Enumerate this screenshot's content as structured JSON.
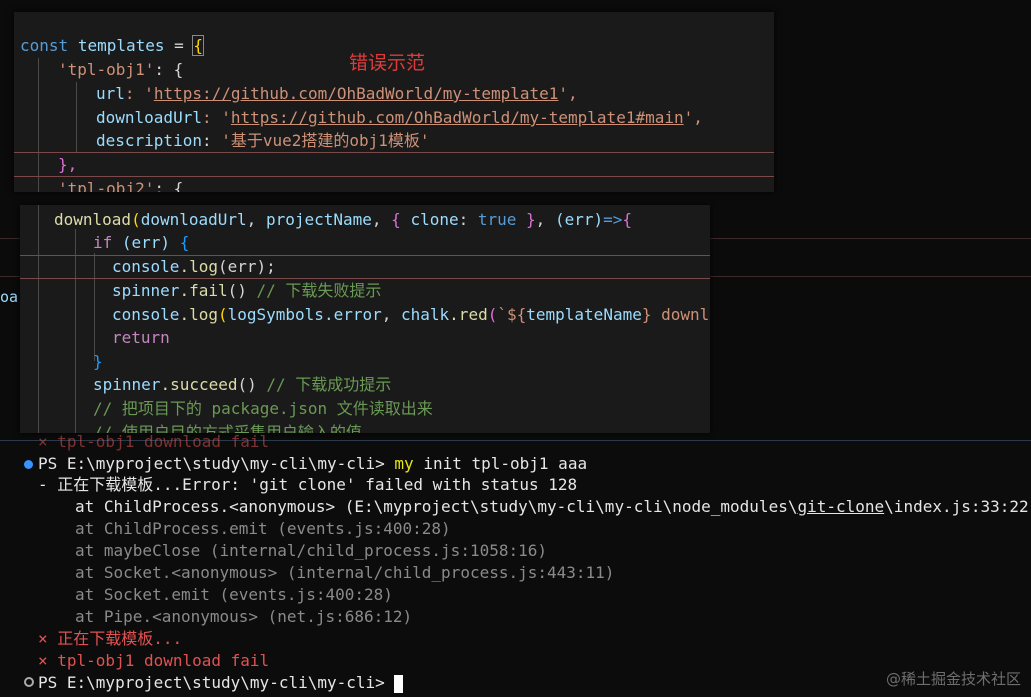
{
  "snippet1": {
    "label": "错误示范",
    "lines": {
      "l1": {
        "kw": "const",
        "name": "templates",
        "eq": " = ",
        "brace": "{"
      },
      "l2": {
        "key": "'tpl-obj1'",
        "rest": ": {"
      },
      "l3": {
        "key": "url",
        "sep": ": '",
        "url": "https://github.com/OhBadWorld/my-template1",
        "end": "',"
      },
      "l4": {
        "key": "downloadUrl",
        "sep": ": '",
        "url": "https://github.com/OhBadWorld/my-template1#main",
        "end": "',"
      },
      "l5": {
        "key": "description",
        "sep": ": ",
        "str": "'基于vue2搭建的obj1模板'"
      },
      "l6": {
        "text": "},"
      },
      "l7": {
        "key": "'tpl-obj2'",
        "rest": ": {"
      }
    }
  },
  "snippet2": {
    "l1": {
      "fn": "download",
      "args1": "(",
      "v1": "downloadUrl",
      "c1": ", ",
      "v2": "projectName",
      "c2": ", ",
      "ob": "{",
      "k": " clone",
      "colon": ": ",
      "t": "true",
      "cb": " }",
      "c3": ", ",
      "p": "(err)",
      "arrow": "=>",
      "ob2": "{"
    },
    "l2": {
      "kw": "if",
      "cond": " (err) ",
      "ob": "{"
    },
    "l3": {
      "obj": "console",
      "fn": ".log",
      "args": "(err);"
    },
    "l4": {
      "obj": "spinner",
      "fn": ".fail",
      "args": "() ",
      "cm": "// 下载失败提示"
    },
    "l5": {
      "obj": "console",
      "fn": ".log",
      "a1": "(",
      "v1": "logSymbols",
      "v2": ".error",
      "c": ", ",
      "v3": "chalk",
      "f2": ".red",
      "a2": "(",
      "s": "`${",
      "tn": "templateName",
      "s2": "} downl"
    },
    "l6": {
      "kw": "return"
    },
    "l7": {
      "text": "}"
    },
    "l8": {
      "obj": "spinner",
      "fn": ".succeed",
      "args": "() ",
      "cm": "// 下载成功提示"
    },
    "l9": {
      "cm": "// 把项目下的 package.json 文件读取出来"
    },
    "l10": {
      "cm": "// 使用户目的方式采集用户输入的值"
    }
  },
  "background": {
    "edge_text": "oa"
  },
  "terminal": {
    "prompt1": "PS E:\\myproject\\study\\my-cli\\my-cli> ",
    "cmd": "my",
    "cmd_args": " init tpl-obj1 aaa",
    "err_line": "- 正在下载模板...Error: 'git clone' failed with status 128",
    "stack1_pre": "at ChildProcess.<anonymous> (E:\\myproject\\study\\my-cli\\my-cli\\node_modules\\",
    "stack1_link": "git-clone",
    "stack1_post": "\\index.js:33:22)",
    "stack2": "at ChildProcess.emit (events.js:400:28)",
    "stack3": "at maybeClose (internal/child_process.js:1058:16)",
    "stack4": "at Socket.<anonymous> (internal/child_process.js:443:11)",
    "stack5": "at Socket.emit (events.js:400:28)",
    "stack6": "at Pipe.<anonymous> (net.js:686:12)",
    "fail1": "× 正在下载模板...",
    "fail2": "× tpl-obj1 download fail",
    "prompt2": "PS E:\\myproject\\study\\my-cli\\my-cli> ",
    "prev_fail": "× tpl-obj1 download fail",
    "watermark": "@稀土掘金技术社区"
  }
}
